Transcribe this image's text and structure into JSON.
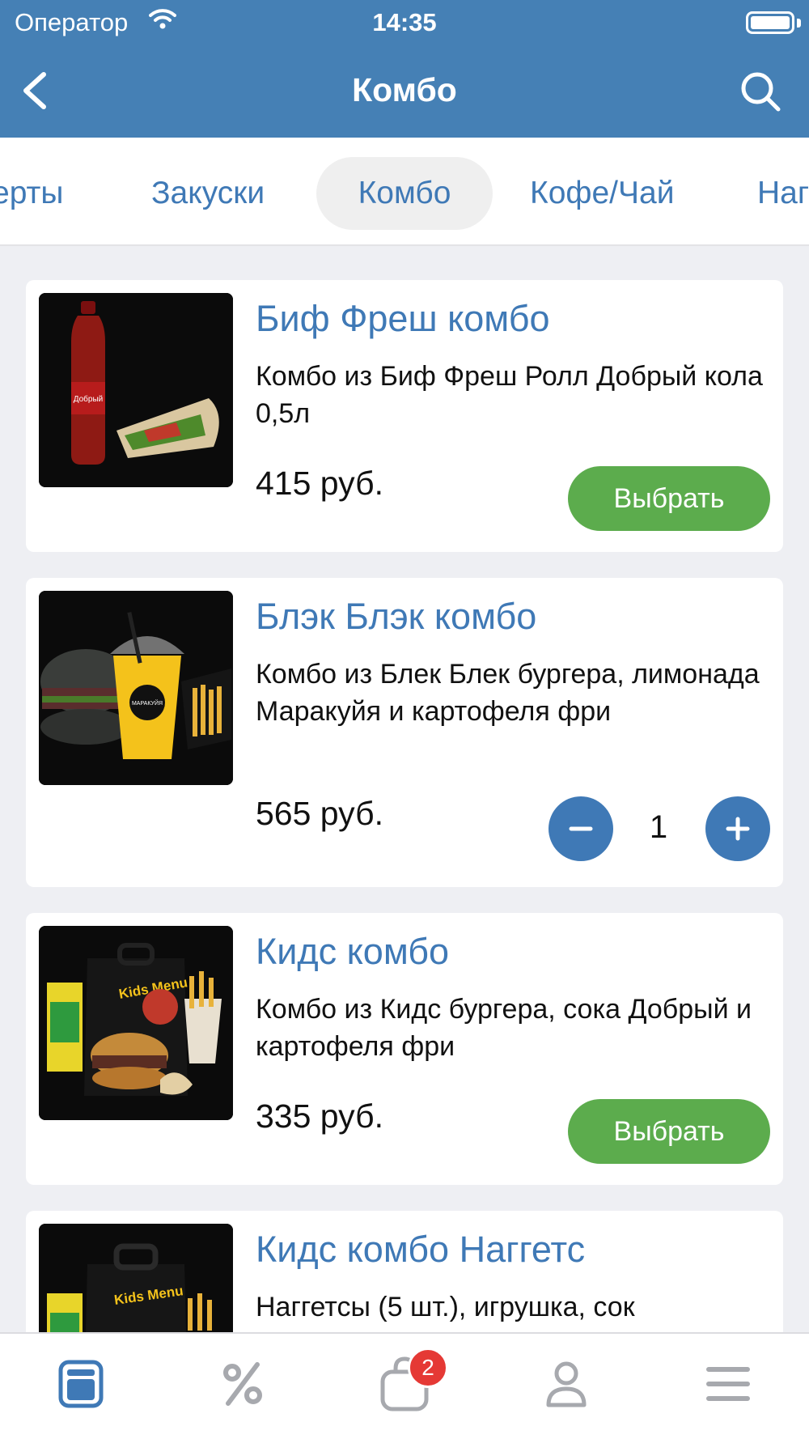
{
  "status_bar": {
    "carrier": "Оператор",
    "time": "14:35"
  },
  "nav": {
    "title": "Комбо"
  },
  "category_tabs": [
    {
      "label": "ерты"
    },
    {
      "label": "Закуски"
    },
    {
      "label": "Комбо",
      "active": true
    },
    {
      "label": "Кофе/Чай"
    },
    {
      "label": "Наг"
    }
  ],
  "products": [
    {
      "title": "Биф Фреш комбо",
      "description": "Комбо из Биф Фреш Ролл Добрый кола 0,5л",
      "price": "415 руб.",
      "action_label": "Выбрать",
      "image_text": "Добрый"
    },
    {
      "title": "Блэк Блэк комбо",
      "description": "Комбо из Блек Блек бургера, лимонада Маракуйя и картофеля фри",
      "price": "565 руб.",
      "quantity": "1",
      "image_text": "МАРАКУЙЯ"
    },
    {
      "title": "Кидс комбо",
      "description": "Комбо из Кидс бургера, сока Добрый и картофеля фри",
      "price": "335 руб.",
      "action_label": "Выбрать",
      "image_text": "Kids Menu"
    },
    {
      "title": "Кидс комбо Наггетс",
      "description": "Наггетсы (5 шт.), игрушка, сок",
      "image_text": "Kids Menu"
    }
  ],
  "tabbar": {
    "items": [
      {
        "icon": "menu-catalog-icon",
        "active": true
      },
      {
        "icon": "percent-icon"
      },
      {
        "icon": "cart-icon"
      },
      {
        "icon": "profile-icon"
      },
      {
        "icon": "hamburger-icon"
      }
    ],
    "cart_badge": "2"
  },
  "colors": {
    "header": "#4580b5",
    "accent_blue": "#3f79b6",
    "button_green": "#5cac4d",
    "badge_red": "#e53935",
    "background": "#eeeff3"
  }
}
